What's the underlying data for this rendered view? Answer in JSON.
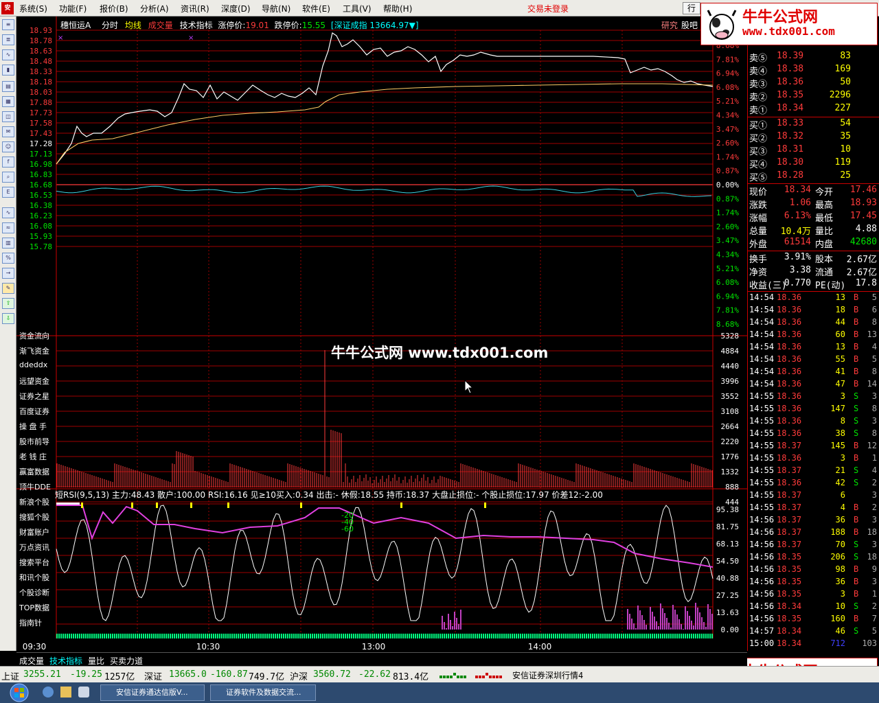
{
  "menu": {
    "items": [
      "系统(S)",
      "功能(F)",
      "报价(B)",
      "分析(A)",
      "资讯(R)",
      "深度(D)",
      "导航(N)",
      "软件(E)",
      "工具(V)",
      "帮助(H)"
    ],
    "status": "交易未登录",
    "right_button": "行"
  },
  "stock": {
    "name": "穗恒运A",
    "tabs": [
      "分时",
      "均线",
      "成交量",
      "技术指标"
    ],
    "limit_up_label": "涨停价:",
    "limit_up": "19.01",
    "limit_down_label": "跌停价:",
    "limit_down": "15.55",
    "index_info": "[深证成指 13664.97▼]",
    "right_tabs": [
      "研究",
      "股吧"
    ]
  },
  "price_axis": [
    "18.93",
    "18.78",
    "18.63",
    "18.48",
    "18.33",
    "18.18",
    "18.03",
    "17.88",
    "17.73",
    "17.58",
    "17.43",
    "17.28",
    "17.13",
    "16.98",
    "16.83",
    "16.68",
    "16.53",
    "16.38",
    "16.23",
    "16.08",
    "15.93",
    "15.78"
  ],
  "pct_axis": [
    "8.68%",
    "7.81%",
    "6.94%",
    "6.08%",
    "5.21%",
    "4.34%",
    "3.47%",
    "2.60%",
    "1.74%",
    "0.87%",
    "0.00%",
    "0.87%",
    "1.74%",
    "2.60%",
    "3.47%",
    "4.34%",
    "5.21%",
    "6.08%",
    "6.94%",
    "7.81%",
    "8.68%"
  ],
  "volume_axis": [
    "5328",
    "4884",
    "4440",
    "3996",
    "3552",
    "3108",
    "2664",
    "2220",
    "1776",
    "1332",
    "888",
    "444"
  ],
  "side_menu": [
    "资金流向",
    "渐飞资金",
    "ddeddx",
    "远望资金",
    "证券之星",
    "百度证券",
    "操 盘 手",
    "股市前导",
    "老 钱 庄",
    "赢富数据",
    "顶牛DDE",
    "新浪个股",
    "搜狐个股",
    "财富账户",
    "万点资讯",
    "搜索平台",
    "和讯个股",
    "个股诊断",
    "TOP数据",
    "指南针"
  ],
  "indicator": {
    "header": "短RSI(9,5,13) 主力:48.43 散户:100.00 RSI:16.16 见≥10买入:0.34 出击:- 休假:18.55 持币:18.37 大盘止损位:- 个股止损位:17.97 价差12:-2.00",
    "axis": [
      "95.38",
      "81.75",
      "68.13",
      "54.50",
      "40.88",
      "27.25",
      "13.63",
      "0.00"
    ],
    "marks": [
      "-20",
      "-40",
      "-60"
    ]
  },
  "time_axis": [
    "09:30",
    "10:30",
    "13:00",
    "14:00"
  ],
  "watermark": {
    "center": "牛牛公式网 www.tdx001.com",
    "title": "牛牛公式网",
    "url": "www.tdx001.com"
  },
  "quotes": {
    "sell": [
      {
        "label": "卖⑤",
        "price": "18.39",
        "vol": "83"
      },
      {
        "label": "卖④",
        "price": "18.38",
        "vol": "169"
      },
      {
        "label": "卖③",
        "price": "18.36",
        "vol": "50"
      },
      {
        "label": "卖②",
        "price": "18.35",
        "vol": "2296"
      },
      {
        "label": "卖①",
        "price": "18.34",
        "vol": "227"
      }
    ],
    "buy": [
      {
        "label": "买①",
        "price": "18.33",
        "vol": "54"
      },
      {
        "label": "买②",
        "price": "18.32",
        "vol": "35"
      },
      {
        "label": "买③",
        "price": "18.31",
        "vol": "10"
      },
      {
        "label": "买④",
        "price": "18.30",
        "vol": "119"
      },
      {
        "label": "买⑤",
        "price": "18.28",
        "vol": "25"
      }
    ],
    "stats": [
      {
        "l1": "现价",
        "v1": "18.34",
        "l2": "今开",
        "v2": "17.46"
      },
      {
        "l1": "涨跌",
        "v1": "1.06",
        "l2": "最高",
        "v2": "18.93"
      },
      {
        "l1": "涨幅",
        "v1": "6.13%",
        "l2": "最低",
        "v2": "17.45"
      },
      {
        "l1": "总量",
        "v1": "10.4万",
        "l2": "量比",
        "v2": "4.88"
      },
      {
        "l1": "外盘",
        "v1": "61514",
        "l2": "内盘",
        "v2": "42680"
      },
      {
        "l1": "换手",
        "v1": "3.91%",
        "l2": "股本",
        "v2": "2.67亿"
      },
      {
        "l1": "净资",
        "v1": "3.38",
        "l2": "流通",
        "v2": "2.67亿"
      },
      {
        "l1": "收益(三)",
        "v1": "0.770",
        "l2": "PE(动)",
        "v2": "17.8"
      }
    ]
  },
  "ticks": [
    {
      "t": "14:54",
      "p": "18.36",
      "v": "13",
      "d": "B",
      "n": "5"
    },
    {
      "t": "14:54",
      "p": "18.36",
      "v": "18",
      "d": "B",
      "n": "6"
    },
    {
      "t": "14:54",
      "p": "18.36",
      "v": "44",
      "d": "B",
      "n": "8"
    },
    {
      "t": "14:54",
      "p": "18.36",
      "v": "60",
      "d": "B",
      "n": "13"
    },
    {
      "t": "14:54",
      "p": "18.36",
      "v": "13",
      "d": "B",
      "n": "4"
    },
    {
      "t": "14:54",
      "p": "18.36",
      "v": "55",
      "d": "B",
      "n": "5"
    },
    {
      "t": "14:54",
      "p": "18.36",
      "v": "41",
      "d": "B",
      "n": "8"
    },
    {
      "t": "14:54",
      "p": "18.36",
      "v": "47",
      "d": "B",
      "n": "14"
    },
    {
      "t": "14:55",
      "p": "18.36",
      "v": "3",
      "d": "S",
      "n": "3"
    },
    {
      "t": "14:55",
      "p": "18.36",
      "v": "147",
      "d": "S",
      "n": "8"
    },
    {
      "t": "14:55",
      "p": "18.36",
      "v": "8",
      "d": "S",
      "n": "3"
    },
    {
      "t": "14:55",
      "p": "18.36",
      "v": "38",
      "d": "S",
      "n": "8"
    },
    {
      "t": "14:55",
      "p": "18.37",
      "v": "145",
      "d": "B",
      "n": "12"
    },
    {
      "t": "14:55",
      "p": "18.36",
      "v": "3",
      "d": "B",
      "n": "1"
    },
    {
      "t": "14:55",
      "p": "18.37",
      "v": "21",
      "d": "S",
      "n": "4"
    },
    {
      "t": "14:55",
      "p": "18.36",
      "v": "42",
      "d": "S",
      "n": "2"
    },
    {
      "t": "14:55",
      "p": "18.37",
      "v": "6",
      "d": "",
      "n": "3"
    },
    {
      "t": "14:55",
      "p": "18.37",
      "v": "4",
      "d": "B",
      "n": "2"
    },
    {
      "t": "14:56",
      "p": "18.37",
      "v": "36",
      "d": "B",
      "n": "3"
    },
    {
      "t": "14:56",
      "p": "18.37",
      "v": "188",
      "d": "B",
      "n": "18"
    },
    {
      "t": "14:56",
      "p": "18.37",
      "v": "70",
      "d": "S",
      "n": "3"
    },
    {
      "t": "14:56",
      "p": "18.35",
      "v": "206",
      "d": "S",
      "n": "18"
    },
    {
      "t": "14:56",
      "p": "18.35",
      "v": "98",
      "d": "B",
      "n": "9"
    },
    {
      "t": "14:56",
      "p": "18.35",
      "v": "36",
      "d": "B",
      "n": "3"
    },
    {
      "t": "14:56",
      "p": "18.35",
      "v": "3",
      "d": "B",
      "n": "1"
    },
    {
      "t": "14:56",
      "p": "18.34",
      "v": "10",
      "d": "S",
      "n": "2"
    },
    {
      "t": "14:56",
      "p": "18.35",
      "v": "160",
      "d": "B",
      "n": "7"
    },
    {
      "t": "14:57",
      "p": "18.34",
      "v": "46",
      "d": "S",
      "n": "5"
    },
    {
      "t": "15:00",
      "p": "18.34",
      "v": "712",
      "d": "",
      "n": "103"
    }
  ],
  "bottom_tabs": [
    "成交量",
    "技术指标",
    "量比",
    "买卖力道"
  ],
  "index_bar": [
    {
      "name": "上证",
      "val": "3255.21",
      "chg": "-19.25",
      "amt": "1257亿"
    },
    {
      "name": "深证",
      "val": "13665.0",
      "chg": "-160.87",
      "amt": "749.7亿"
    },
    {
      "name": "沪深",
      "val": "3560.72",
      "chg": "-22.62",
      "amt": "813.4亿"
    }
  ],
  "index_bar_broker": "安信证券深圳行情4",
  "taskbar": {
    "items": [
      "安信证券通达信版V...",
      "证券软件及数据交流..."
    ]
  }
}
